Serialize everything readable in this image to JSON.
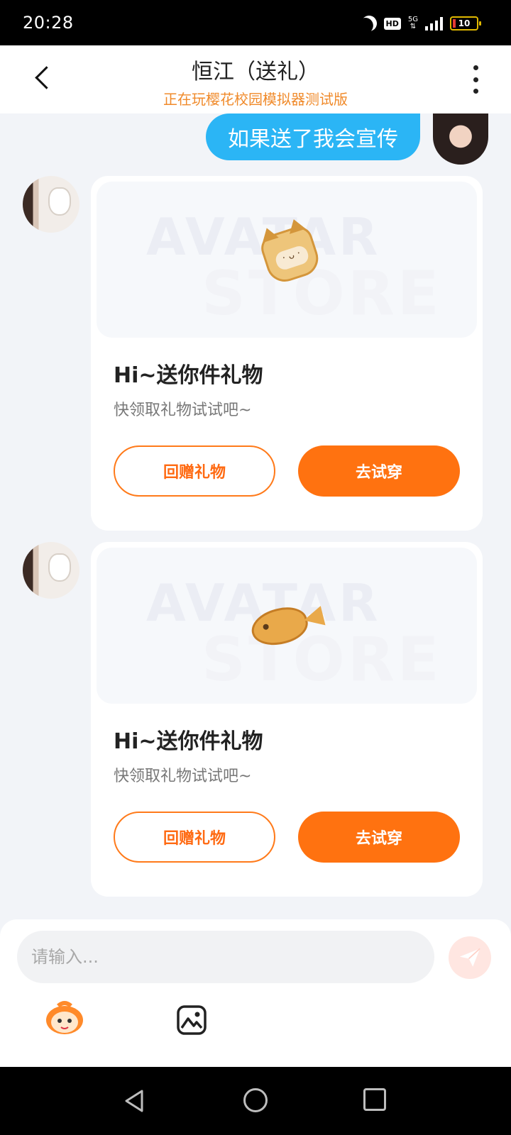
{
  "status_bar": {
    "time": "20:28",
    "hd": "HD",
    "network": "5G",
    "battery": "10"
  },
  "header": {
    "title": "恒江（送礼）",
    "subtitle": "正在玩樱花校园模拟器测试版"
  },
  "messages": {
    "mine": {
      "text": "如果送了我会宣传"
    },
    "gifts": [
      {
        "watermark_line1": "AVATAR",
        "watermark_line2": "STORE",
        "title": "Hi~送你件礼物",
        "desc": "快领取礼物试试吧~",
        "return_label": "回赠礼物",
        "try_label": "去试穿",
        "icon": "cat-cookie-icon"
      },
      {
        "watermark_line1": "AVATAR",
        "watermark_line2": "STORE",
        "title": "Hi~送你件礼物",
        "desc": "快领取礼物试试吧~",
        "return_label": "回赠礼物",
        "try_label": "去试穿",
        "icon": "fish-cookie-icon"
      }
    ]
  },
  "input": {
    "placeholder": "请输入..."
  },
  "colors": {
    "accent": "#ff7210",
    "bubble": "#2bb5f5",
    "subtitle": "#f08a2a"
  }
}
